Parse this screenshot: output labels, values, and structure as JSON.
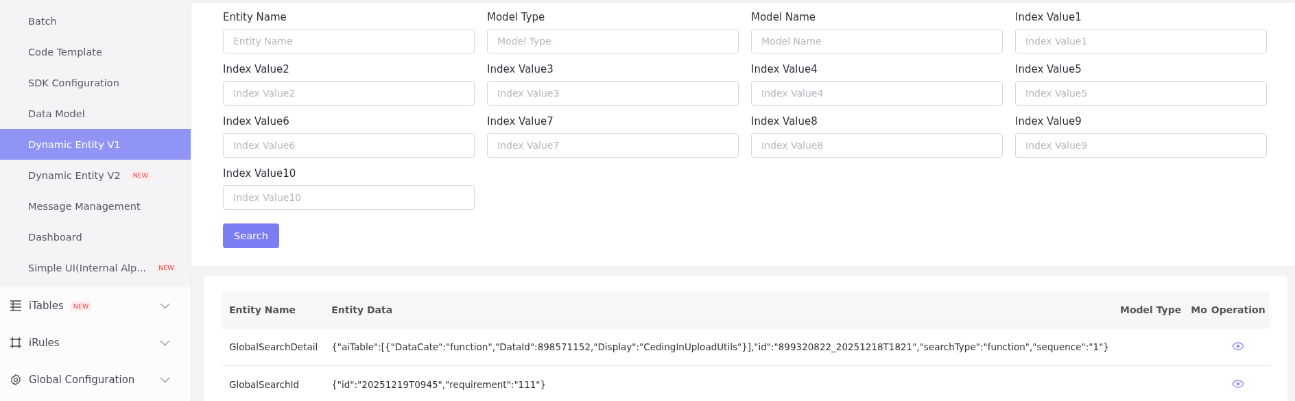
{
  "sidebar": {
    "submenu_items": [
      {
        "label": "Batch",
        "selected": false
      },
      {
        "label": "Code Template",
        "selected": false
      },
      {
        "label": "SDK Configuration",
        "selected": false
      },
      {
        "label": "Data Model",
        "selected": false
      },
      {
        "label": "Dynamic Entity V1",
        "selected": true
      },
      {
        "label": "Dynamic Entity V2",
        "selected": false,
        "badge": "NEW"
      },
      {
        "label": "Message Management",
        "selected": false
      },
      {
        "label": "Dashboard",
        "selected": false
      },
      {
        "label": "Simple UI(Internal Alp...",
        "selected": false,
        "badge": "NEW"
      }
    ],
    "groups": [
      {
        "label": "iTables",
        "kind": "table",
        "badge": "NEW",
        "expanded": false
      },
      {
        "label": "iRules",
        "kind": "rules",
        "expanded": false
      },
      {
        "label": "Global Configuration",
        "kind": "gear",
        "expanded": false
      }
    ]
  },
  "search_form": {
    "fields": [
      {
        "label": "Entity Name",
        "placeholder": "Entity Name"
      },
      {
        "label": "Model Type",
        "placeholder": "Model Type"
      },
      {
        "label": "Model Name",
        "placeholder": "Model Name"
      },
      {
        "label": "Index Value1",
        "placeholder": "Index Value1"
      },
      {
        "label": "Index Value2",
        "placeholder": "Index Value2"
      },
      {
        "label": "Index Value3",
        "placeholder": "Index Value3"
      },
      {
        "label": "Index Value4",
        "placeholder": "Index Value4"
      },
      {
        "label": "Index Value5",
        "placeholder": "Index Value5"
      },
      {
        "label": "Index Value6",
        "placeholder": "Index Value6"
      },
      {
        "label": "Index Value7",
        "placeholder": "Index Value7"
      },
      {
        "label": "Index Value8",
        "placeholder": "Index Value8"
      },
      {
        "label": "Index Value9",
        "placeholder": "Index Value9"
      },
      {
        "label": "Index Value10",
        "placeholder": "Index Value10"
      }
    ],
    "button": "Search"
  },
  "table": {
    "columns": [
      "Entity Name",
      "Entity Data",
      "Model Type",
      "Mo",
      "Operation"
    ],
    "rows": [
      {
        "entity_name": "GlobalSearchDetail",
        "entity_data": "{\"aiTable\":[{\"DataCate\":\"function\",\"DataId\":898571152,\"Display\":\"CedingInUploadUtils\"}],\"id\":\"899320822_20251218T1821\",\"searchType\":\"function\",\"sequence\":\"1\"}"
      },
      {
        "entity_name": "GlobalSearchId",
        "entity_data": "{\"id\":\"20251219T0945\",\"requirement\":\"111\"}"
      }
    ]
  }
}
